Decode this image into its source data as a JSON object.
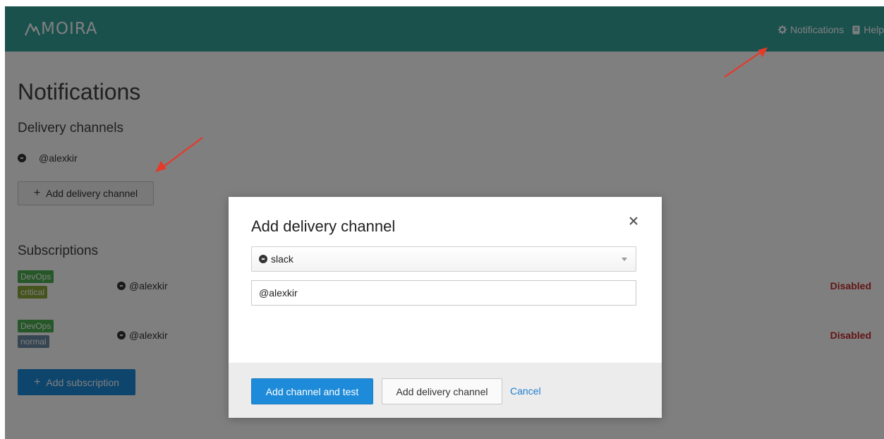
{
  "app": {
    "logo_text": "MOIRA",
    "nav": [
      {
        "label": "Notifications",
        "icon": "gear-icon"
      },
      {
        "label": "Help",
        "icon": "book-icon"
      }
    ]
  },
  "page": {
    "title": "Notifications",
    "delivery_section": {
      "title": "Delivery channels",
      "channels": [
        {
          "type": "slack",
          "name": "@alexkir"
        }
      ],
      "add_button": "Add delivery channel"
    },
    "subscriptions_section": {
      "title": "Subscriptions",
      "rows": [
        {
          "tags": [
            "DevOps",
            "critical"
          ],
          "channel": "@alexkir",
          "status": "Disabled"
        },
        {
          "tags": [
            "DevOps",
            "normal"
          ],
          "channel": "@alexkir",
          "status": "Disabled"
        }
      ],
      "add_button": "Add subscription"
    }
  },
  "modal": {
    "title": "Add delivery channel",
    "channel_type_select": {
      "value": "slack",
      "icon": "slack-icon"
    },
    "contact_input": {
      "value": "@alexkir"
    },
    "buttons": {
      "primary": "Add channel and test",
      "secondary": "Add delivery channel",
      "cancel": "Cancel"
    }
  },
  "colors": {
    "header": "#34a39a",
    "primary": "#1d8bd9",
    "disabled_status": "#c72b2b",
    "tag_devops": "#4caf50",
    "tag_critical": "#8aa83a",
    "tag_normal": "#6c8aa5",
    "annotation_arrow": "#e53a2a"
  }
}
